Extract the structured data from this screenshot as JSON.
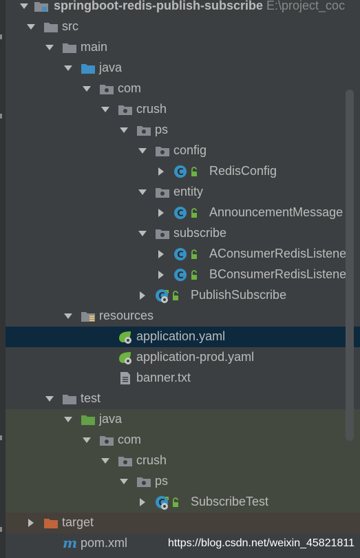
{
  "project_tree": {
    "root": {
      "label": "springboot-redis-publish-subscribe",
      "path": "E:\\project_coc"
    },
    "rows": [
      {
        "label": "src"
      },
      {
        "label": "main"
      },
      {
        "label": "java"
      },
      {
        "label": "com"
      },
      {
        "label": "crush"
      },
      {
        "label": "ps"
      },
      {
        "label": "config"
      },
      {
        "label": "RedisConfig"
      },
      {
        "label": "entity"
      },
      {
        "label": "AnnouncementMessage"
      },
      {
        "label": "subscribe"
      },
      {
        "label": "AConsumerRedisListene"
      },
      {
        "label": "BConsumerRedisListene"
      },
      {
        "label": "PublishSubscribe"
      },
      {
        "label": "resources"
      },
      {
        "label": "application.yaml"
      },
      {
        "label": "application-prod.yaml"
      },
      {
        "label": "banner.txt"
      },
      {
        "label": "test"
      },
      {
        "label": "java"
      },
      {
        "label": "com"
      },
      {
        "label": "crush"
      },
      {
        "label": "ps"
      },
      {
        "label": "SubscribeTest"
      },
      {
        "label": "target"
      },
      {
        "label": "pom.xml"
      }
    ],
    "selected_item": "application.yaml"
  },
  "icons": {
    "project": "module-icon",
    "folder": "folder-icon",
    "source_root": "java-source-root-icon",
    "test_root": "test-source-root-icon",
    "package": "package-icon",
    "resources": "resources-folder-icon",
    "class": "class-icon",
    "spring_boot": "spring-boot-class-icon",
    "spring_config": "spring-config-yaml-icon",
    "text_file": "text-file-icon",
    "excluded": "excluded-folder-icon",
    "maven": "maven-icon"
  },
  "colors": {
    "background": "#3c3f41",
    "selection": "#0d293e",
    "test_highlight": "#44493f",
    "excluded_highlight": "#46403b",
    "text": "#bbbbbb",
    "class_icon": "#3592c4",
    "folder_icon": "#878b91",
    "source_root_icon": "#3d8fc6",
    "test_root_icon": "#62a146",
    "excluded_icon": "#c0643b",
    "spring_green": "#6db33f"
  },
  "watermark": "https://blog.csdn.net/weixin_45821811"
}
